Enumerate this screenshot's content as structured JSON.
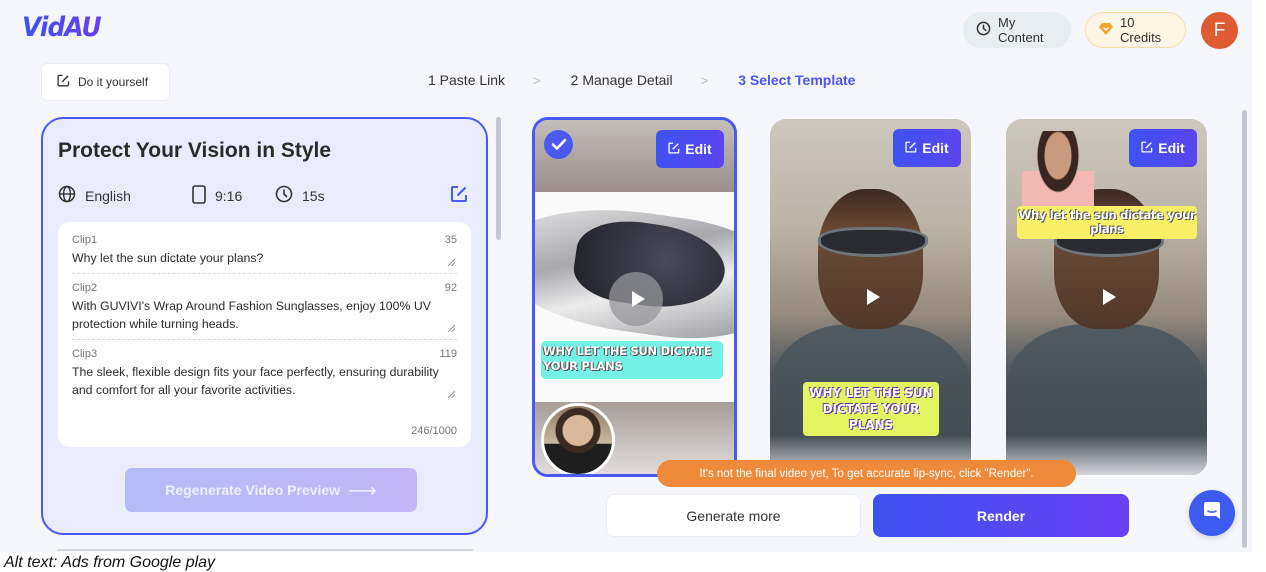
{
  "app": {
    "logo": "VidAU"
  },
  "header": {
    "my_content_label": "My Content",
    "credits_label": "10 Credits",
    "avatar_initial": "F"
  },
  "toolbar": {
    "diy_label": "Do it yourself"
  },
  "steps": [
    {
      "label": "1 Paste Link",
      "active": false
    },
    {
      "label": "2 Manage Detail",
      "active": false
    },
    {
      "label": "3 Select Template",
      "active": true
    }
  ],
  "step_separator": ">",
  "script_panel": {
    "title": "Protect Your Vision in Style",
    "language": "English",
    "ratio": "9:16",
    "duration": "15s",
    "clips": [
      {
        "label": "Clip1",
        "count": "35",
        "text": "Why let the sun dictate your plans?"
      },
      {
        "label": "Clip2",
        "count": "92",
        "text": " With GUVIVI's Wrap Around Fashion Sunglasses, enjoy 100% UV protection while turning heads."
      },
      {
        "label": "Clip3",
        "count": "119",
        "text": " The sleek, flexible design fits your face perfectly, ensuring durability and comfort for all your favorite activities."
      }
    ],
    "total_count": "246/1000",
    "regenerate_label": "Regenerate Video Preview",
    "regenerate_arrow": "⟶"
  },
  "templates": [
    {
      "edit_label": "Edit",
      "selected": true,
      "caption": "Why let the sun dictate your plans"
    },
    {
      "edit_label": "Edit",
      "selected": false,
      "caption": "Why let the sun dictate your plans"
    },
    {
      "edit_label": "Edit",
      "selected": false,
      "caption": "Why let the sun dictate your plans"
    }
  ],
  "tip": "It's not the final video yet, To get accurate lip-sync, click \"Render\".",
  "actions": {
    "generate_more_label": "Generate more",
    "render_label": "Render"
  },
  "footer": {
    "alt_text": "Alt text: Ads from Google play"
  },
  "colors": {
    "accent": "#4a5af0",
    "tip": "#ef8a3b",
    "avatar": "#e05a33",
    "credits_bg": "#fff5e4"
  }
}
